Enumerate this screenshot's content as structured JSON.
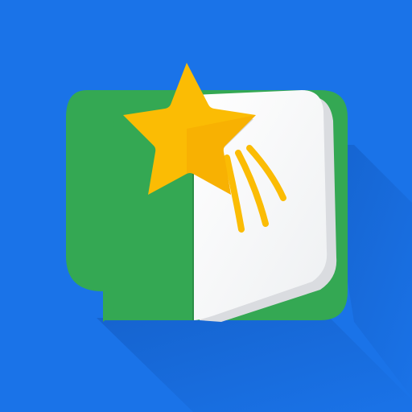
{
  "icon": {
    "name": "reading-app-icon",
    "description_semantic": "book-with-shooting-star-icon",
    "colors": {
      "background": "#1a73e8",
      "speech_bubble_green": "#34a853",
      "speech_bubble_green_dark": "#2b8e46",
      "page_white": "#ffffff",
      "page_edge_gray": "#dadce0",
      "star_yellow": "#fbbc04",
      "star_yellow_dark": "#f4a300",
      "shadow": "#1558b0"
    }
  }
}
